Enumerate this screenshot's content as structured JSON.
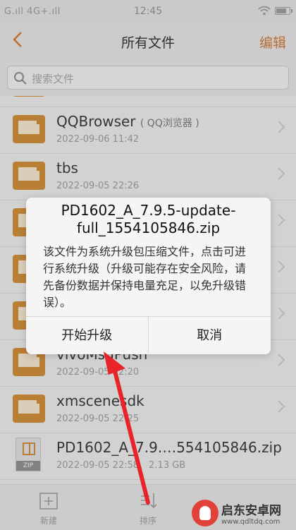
{
  "status_bar": {
    "left": "G.ıll 4G+.ıll",
    "time": "12:45"
  },
  "header": {
    "back_icon": "chevron-left-icon",
    "title": "所有文件",
    "edit": "编辑"
  },
  "search": {
    "placeholder": "搜索文件"
  },
  "files": [
    {
      "name": "QQBrowser",
      "sub": "( QQ浏览器 )",
      "date": "2022-09-06 11:42",
      "size": "",
      "type": "folder"
    },
    {
      "name": "tbs",
      "sub": "",
      "date": "2022-09-05 22:26",
      "size": "",
      "type": "folder"
    },
    {
      "name": "",
      "sub": "",
      "date": "",
      "size": "",
      "type": "folder"
    },
    {
      "name": "",
      "sub": "",
      "date": "",
      "size": "",
      "type": "folder"
    },
    {
      "name": "",
      "sub": "",
      "date": "",
      "size": "",
      "type": "folder"
    },
    {
      "name": "vivoMsgPush",
      "sub": "",
      "date": "2022-09-05 22:20",
      "size": "",
      "type": "folder"
    },
    {
      "name": "xmscenesdk",
      "sub": "",
      "date": "2022-09-05 22:25",
      "size": "",
      "type": "folder"
    },
    {
      "name": "PD1602_A_7.9.…554105846.zip",
      "sub": "",
      "date": "2022-09-05 22:58",
      "size": "2.13 GB",
      "type": "zip",
      "tag": "ZIP"
    }
  ],
  "bottom_bar": {
    "new": "新建",
    "sort": "排序"
  },
  "dialog": {
    "title_line1": "PD1602_A_7.9.5-update-",
    "title_line2": "full_1554105846.zip",
    "message": "该文件为系统升级包压缩文件，点击可进行系统升级（升级可能存在安全风险，请先备份数据并保持电量充足，以免升级错误）。",
    "confirm": "开始升级",
    "cancel": "取消"
  },
  "watermark": {
    "name": "启东安卓网",
    "url": "www.qdltdq.com"
  },
  "colors": {
    "accent": "#c8773a",
    "folder": "#c98a3a",
    "arrow": "#e8232a"
  }
}
